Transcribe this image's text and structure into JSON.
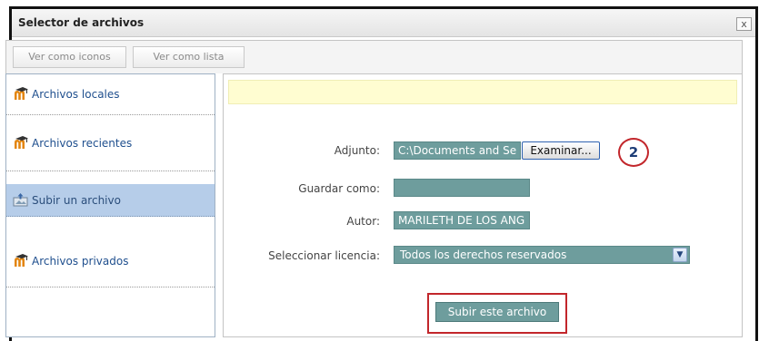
{
  "dialog": {
    "title": "Selector de archivos",
    "close_label": "x"
  },
  "toolbar": {
    "icons_view_label": "Ver como iconos",
    "list_view_label": "Ver como lista"
  },
  "sidebar": {
    "items": [
      {
        "label": "Archivos locales",
        "icon": "moodle-repository-icon",
        "active": false
      },
      {
        "label": "Archivos recientes",
        "icon": "moodle-repository-icon",
        "active": false
      },
      {
        "label": "Subir un archivo",
        "icon": "upload-icon",
        "active": true
      },
      {
        "label": "Archivos privados",
        "icon": "moodle-repository-icon",
        "active": false
      }
    ]
  },
  "form": {
    "attachment_label": "Adjunto:",
    "attachment_value": "C:\\Documents and Se",
    "browse_label": "Examinar...",
    "step_badge": "2",
    "save_as_label": "Guardar como:",
    "save_as_value": "",
    "author_label": "Autor:",
    "author_value": "MARILETH DE LOS ANG",
    "license_label": "Seleccionar licencia:",
    "license_value": "Todos los derechos reservados",
    "submit_label": "Subir este archivo"
  },
  "colors": {
    "field_bg": "#6e9d9d",
    "active_item_bg": "#b6cde9",
    "notice_bg": "#fffdd1",
    "highlight_red": "#c2262b"
  }
}
